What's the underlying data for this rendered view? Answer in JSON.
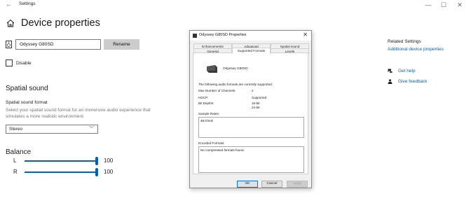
{
  "window": {
    "app_title": "Settings",
    "back_icon": "back-arrow-icon",
    "minimize_glyph": "—",
    "maximize_glyph": "☐",
    "close_glyph": "✕"
  },
  "page": {
    "title": "Device properties",
    "home_icon": "home-icon"
  },
  "device": {
    "name_value": "Odyssey G80SD",
    "rename_label": "Rename",
    "disable_label": "Disable"
  },
  "spatial": {
    "heading": "Spatial sound",
    "format_label": "Spatial sound format",
    "description": "Select your spatial sound format for an immersive audio experience that simulates a more realistic environment.",
    "selected": "Stereo"
  },
  "balance": {
    "heading": "Balance",
    "channels": [
      {
        "label": "L",
        "value": "100",
        "level": 1.0
      },
      {
        "label": "R",
        "value": "100",
        "level": 1.0
      }
    ]
  },
  "dialog": {
    "title": "Odyssey G80SD Properties",
    "tabs_top": [
      "Enhancements",
      "Advanced",
      "Spatial sound"
    ],
    "tabs_bottom": [
      "General",
      "Supported Formats",
      "Levels"
    ],
    "active_tab": "Supported Formats",
    "device_name": "Odyssey G80SD",
    "intro": "The following audio formats are currently supported:",
    "max_channels_label": "Max Number of Channels:",
    "max_channels_value": "2",
    "hdcp_label": "HDCP:",
    "hdcp_value": "Supported",
    "bit_depths_label": "Bit Depths:",
    "bit_depths": [
      "16-bit",
      "24-bit"
    ],
    "sample_rates_label": "Sample Rates:",
    "sample_rates": [
      "48.0 kHz"
    ],
    "encoded_label": "Encoded Formats:",
    "encoded": [
      "No compressed formats found."
    ],
    "ok_label": "OK",
    "cancel_label": "Cancel",
    "apply_label": "Apply"
  },
  "related": {
    "heading": "Related Settings",
    "link": "Additional device properties",
    "help": "Get help",
    "feedback": "Give feedback"
  },
  "colors": {
    "accent": "#0063b1",
    "rename_bg": "#cccccc"
  }
}
